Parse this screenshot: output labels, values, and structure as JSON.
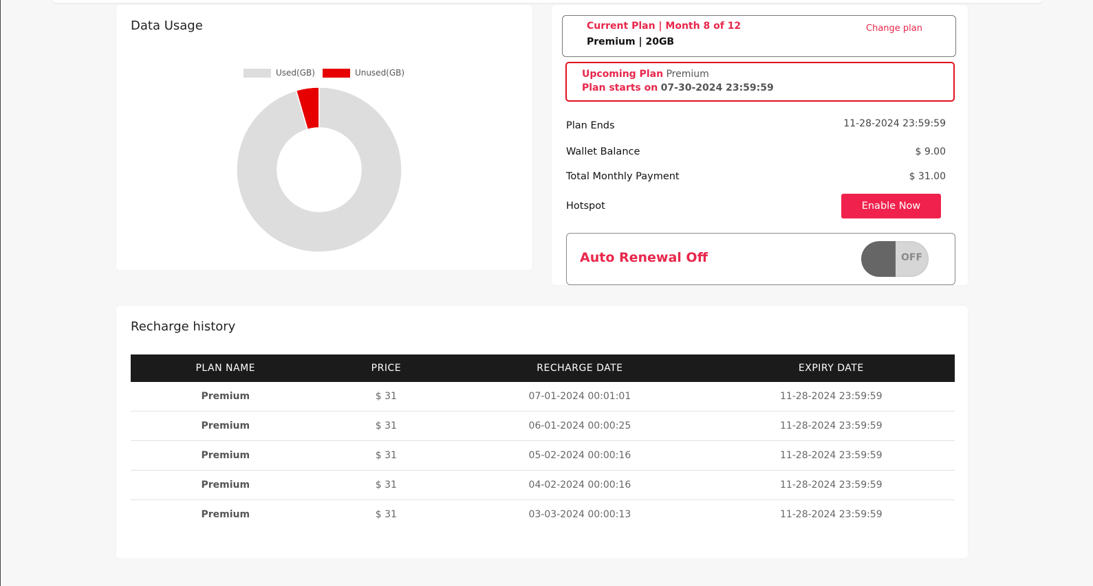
{
  "data_usage": {
    "title": "Data Usage",
    "legend": [
      {
        "label": "Used(GB)",
        "color": "#dddddd"
      },
      {
        "label": "Unused(GB)",
        "color": "#e60000"
      }
    ],
    "chart_data": {
      "type": "pie",
      "categories": [
        "Used(GB)",
        "Unused(GB)"
      ],
      "values": [
        19.1,
        0.9
      ],
      "colors": [
        "#dddddd",
        "#e60000"
      ],
      "legend": "top"
    }
  },
  "current_plan": {
    "title": "Current Plan | Month 8 of 12",
    "subtitle": "Premium | 20GB",
    "change_label": "Change plan"
  },
  "upcoming_plan": {
    "label": "Upcoming Plan",
    "name": "Premium",
    "starts_label": "Plan starts on",
    "starts_value": "07-30-2024 23:59:59"
  },
  "details": {
    "plan_ends_label": "Plan Ends",
    "plan_ends_value": "11-28-2024 23:59:59",
    "wallet_label": "Wallet Balance",
    "wallet_value": "$ 9.00",
    "monthly_label": "Total Monthly Payment",
    "monthly_value": "$ 31.00",
    "hotspot_label": "Hotspot",
    "hotspot_button": "Enable Now"
  },
  "auto_renewal": {
    "label": "Auto Renewal Off",
    "toggle_text": "OFF"
  },
  "recharge_history": {
    "title": "Recharge history",
    "columns": [
      "PLAN NAME",
      "PRICE",
      "RECHARGE DATE",
      "EXPIRY DATE"
    ],
    "rows": [
      [
        "Premium",
        "$ 31",
        "07-01-2024 00:01:01",
        "11-28-2024 23:59:59"
      ],
      [
        "Premium",
        "$ 31",
        "06-01-2024 00:00:25",
        "11-28-2024 23:59:59"
      ],
      [
        "Premium",
        "$ 31",
        "05-02-2024 00:00:16",
        "11-28-2024 23:59:59"
      ],
      [
        "Premium",
        "$ 31",
        "04-02-2024 00:00:16",
        "11-28-2024 23:59:59"
      ],
      [
        "Premium",
        "$ 31",
        "03-03-2024 00:00:13",
        "11-28-2024 23:59:59"
      ]
    ]
  }
}
